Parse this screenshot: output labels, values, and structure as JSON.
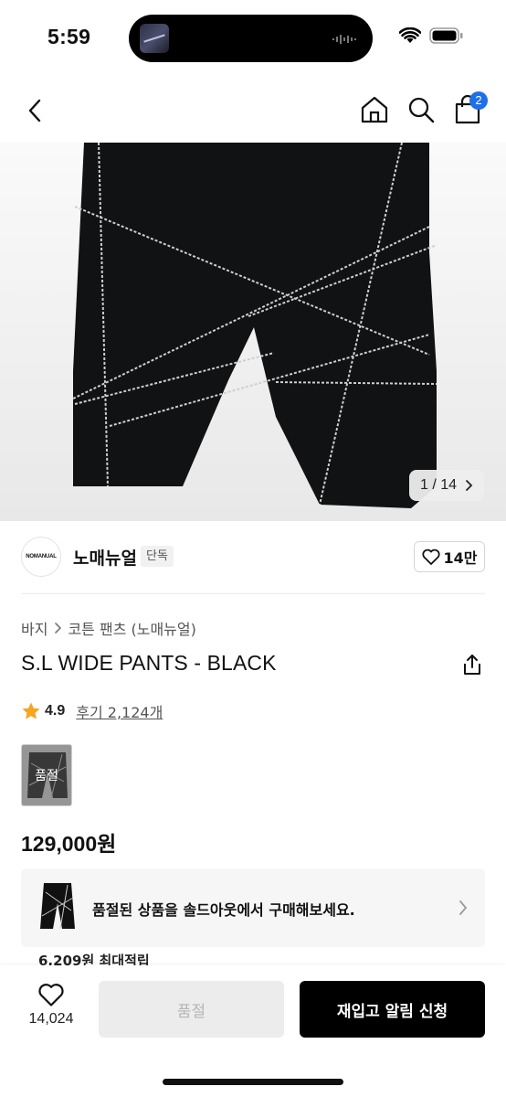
{
  "status_bar": {
    "time": "5:59"
  },
  "nav": {
    "cart_count": "2"
  },
  "gallery": {
    "counter": "1 / 14"
  },
  "brand": {
    "logo_text": "NOMANUAL",
    "name": "노매뉴얼",
    "badge": "단독",
    "likes": "14만"
  },
  "breadcrumb": {
    "items": [
      "바지",
      "코튼 팬츠 (노매뉴얼)"
    ]
  },
  "product": {
    "title": "S.L WIDE PANTS - BLACK",
    "rating": "4.9",
    "reviews": "후기 2,124개",
    "variant_label": "품절",
    "price": "129,000원"
  },
  "soldout_banner": {
    "text": "품절된 상품을 솔드아웃에서 구매해보세요."
  },
  "points": {
    "text": "6,209원 최대적립"
  },
  "bottom_bar": {
    "wishlist_count": "14,024",
    "soldout_label": "품절",
    "restock_label": "재입고 알림 신청"
  },
  "colors": {
    "badge_blue": "#1f6fe8",
    "star": "#f5a623",
    "primary_button": "#000000",
    "disabled_button": "#ececec"
  },
  "icons": [
    "chevron-left-icon",
    "home-icon",
    "search-icon",
    "shopping-bag-icon",
    "heart-icon",
    "share-icon",
    "star-icon",
    "chevron-right-icon",
    "wifi-icon",
    "battery-icon"
  ]
}
